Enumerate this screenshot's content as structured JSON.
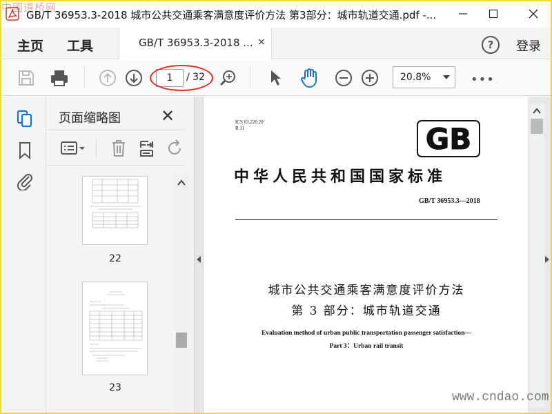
{
  "window": {
    "title": "GB/T 36953.3-2018 城市公共交通乘客满意度评价方法 第3部分：城市轨道交通.pdf -...",
    "watermark": "中国道桥网",
    "minimize_icon": "minimize-icon",
    "maximize_icon": "maximize-icon",
    "close_icon": "close-icon"
  },
  "menu": {
    "home": "主页",
    "tools": "工具",
    "tab_label": "GB/T 36953.3-2018 ...",
    "tab_close": "×",
    "help": "?",
    "login": "登录"
  },
  "toolbar": {
    "page_current": "1",
    "page_total": "/ 32",
    "zoom": "20.8%",
    "more": "•••"
  },
  "thumbnails": {
    "pane_title": "页面缩略图",
    "close": "✕",
    "pages": [
      {
        "num": "22"
      },
      {
        "num": "23"
      }
    ]
  },
  "document": {
    "ics": "ICS  03.220.20",
    "class_code": "R  11",
    "logo": "GB",
    "standard_title": "中华人民共和国国家标准",
    "standard_number": "GB/T  36953.3—2018",
    "cn_title_1": "城市公共交通乘客满意度评价方法",
    "cn_title_2": "第 3 部分：城市轨道交通",
    "en_title_1": "Evaluation method of urban public transportation passenger satisfaction—",
    "en_title_2": "Part 3：Urban rail transit"
  },
  "site_watermark": "www.cndao.com",
  "colors": {
    "frame": "#f1d832",
    "annotation": "#e8281f",
    "hand_tool": "#1a73c8",
    "rail_active": "#1a73c8"
  }
}
